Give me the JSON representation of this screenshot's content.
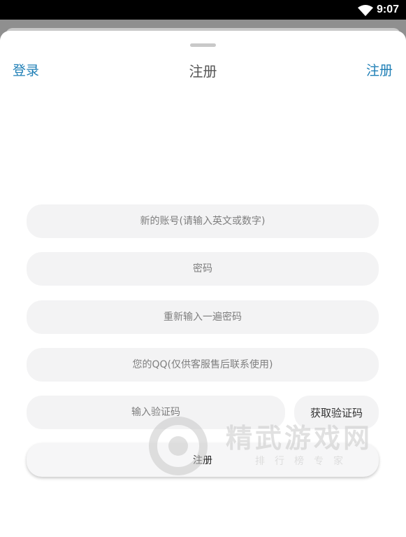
{
  "status_bar": {
    "time": "9:07"
  },
  "header": {
    "left_label": "登录",
    "title": "注册",
    "right_label": "注册"
  },
  "form": {
    "account_placeholder": "新的账号(请输入英文或数字)",
    "password_placeholder": "密码",
    "password_confirm_placeholder": "重新输入一遍密码",
    "qq_placeholder": "您的QQ(仅供客服售后联系使用)",
    "code_placeholder": "输入验证码",
    "get_code_label": "获取验证码",
    "submit_label": "注册"
  },
  "watermark": {
    "title": "精武游戏网",
    "subtitle": "排行榜专家"
  },
  "colors": {
    "accent": "#1f7fb6",
    "field_bg": "#f3f3f4",
    "backdrop": "#8f8f8f"
  }
}
